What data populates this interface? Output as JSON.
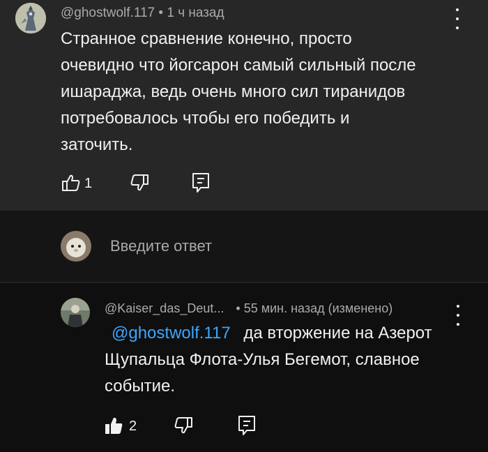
{
  "top_comment": {
    "author": "@ghostwolf.117",
    "separator": "•",
    "time": "1 ч назад",
    "text_lines": [
      "Странное сравнение конечно, просто",
      "очевидно что йогсарон самый сильный после",
      "ишараджа, ведь очень много сил тиранидов",
      "потребовалось чтобы его победить и",
      "заточить."
    ],
    "like_count": "1"
  },
  "reply_input": {
    "placeholder": "Введите ответ"
  },
  "reply": {
    "author": "@Kaiser_das_Deut...",
    "separator": "•",
    "time": "55 мин. назад (изменено)",
    "mention": "@ghostwolf.117",
    "text_line1_rest": "да вторжение на Азерот",
    "text_line2": "Щупальца Флота-Улья Бегемот, славное",
    "text_line3": "событие.",
    "like_count": "2"
  },
  "icons": [
    "avatar",
    "kebab-menu-icon",
    "like-icon",
    "dislike-icon",
    "reply-icon"
  ]
}
